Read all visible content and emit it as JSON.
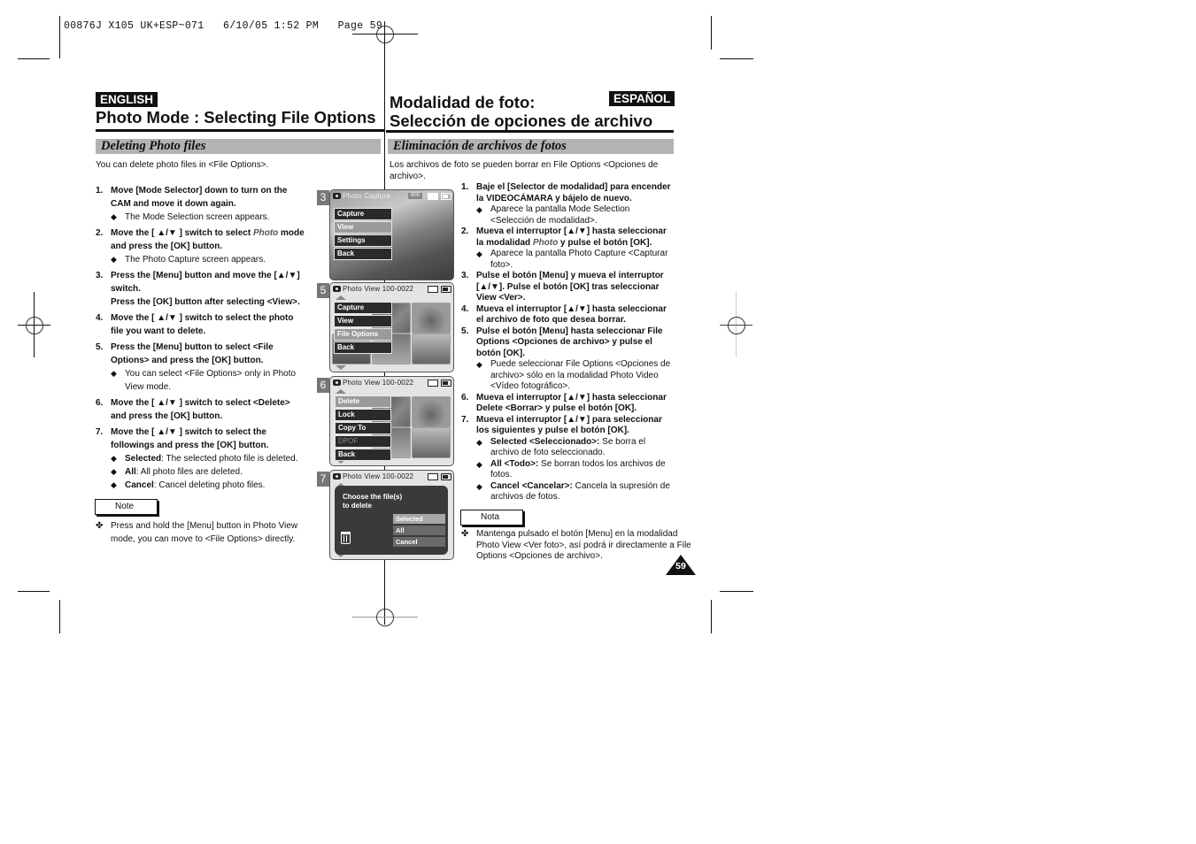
{
  "slug": "00876J X105 UK+ESP~071   6/10/05 1:52 PM   Page 59",
  "english": {
    "badge": "ENGLISH",
    "title": "Photo Mode : Selecting File Options",
    "section": "Deleting Photo files",
    "intro": "You can delete photo files in <File Options>.",
    "steps": [
      {
        "num": "1.",
        "text": "Move [Mode Selector] down to turn on the CAM and move it down again.",
        "bullets": [
          {
            "bold": "",
            "text": "The Mode Selection screen appears."
          }
        ]
      },
      {
        "num": "2.",
        "pre": "Move the [ ▲/▼ ] switch to select ",
        "ital": "Photo",
        "post": " mode and press the [OK] button.",
        "bullets": [
          {
            "bold": "",
            "text": "The Photo Capture screen appears."
          }
        ]
      },
      {
        "num": "3.",
        "text": "Press the [Menu] button and move the [▲/▼] switch.",
        "text2": "Press the [OK] button after selecting <View>.",
        "bullets": []
      },
      {
        "num": "4.",
        "text": "Move the [ ▲/▼ ] switch to select the photo file you want to delete.",
        "bullets": []
      },
      {
        "num": "5.",
        "text": "Press the [Menu] button to select <File Options> and press the [OK] button.",
        "bullets": [
          {
            "bold": "",
            "text": "You can select <File Options> only in Photo View mode."
          }
        ]
      },
      {
        "num": "6.",
        "text": "Move the [ ▲/▼ ] switch to select <Delete> and press the [OK] button.",
        "bullets": []
      },
      {
        "num": "7.",
        "text": "Move the [ ▲/▼ ] switch to select the followings and press the [OK] button.",
        "bullets": [
          {
            "bold": "Selected",
            "text": ": The selected photo file is deleted."
          },
          {
            "bold": "All",
            "text": ": All photo files are deleted."
          },
          {
            "bold": "Cancel",
            "text": ": Cancel deleting photo files."
          }
        ]
      }
    ],
    "note_label": "Note",
    "note_symbol": "✤",
    "note_text": "Press and hold the [Menu] button in Photo View mode, you can move to <File Options> directly."
  },
  "spanish": {
    "badge": "ESPAÑOL",
    "title_line1": "Modalidad de foto:",
    "title_line2": "Selección de opciones de archivo",
    "section": "Eliminación de archivos de fotos",
    "intro": "Los archivos de foto se pueden borrar en File Options <Opciones de archivo>.",
    "steps": [
      {
        "num": "1.",
        "text": "Baje el [Selector de modalidad] para encender la VIDEOCÁMARA y bájelo de nuevo.",
        "bullets": [
          {
            "bold": "",
            "text": "Aparece la pantalla Mode Selection <Selección de modalidad>."
          }
        ]
      },
      {
        "num": "2.",
        "pre": "Mueva el interruptor [▲/▼] hasta seleccionar la modalidad ",
        "ital": "Photo",
        "post": " y pulse el botón [OK].",
        "bullets": [
          {
            "bold": "",
            "text": "Aparece la pantalla Photo Capture <Capturar foto>."
          }
        ]
      },
      {
        "num": "3.",
        "text": "Pulse el botón [Menu] y mueva el interruptor [▲/▼]. Pulse el botón [OK] tras seleccionar View <Ver>.",
        "bullets": []
      },
      {
        "num": "4.",
        "text": "Mueva el interruptor [▲/▼] hasta seleccionar el archivo de foto que desea borrar.",
        "bullets": []
      },
      {
        "num": "5.",
        "text": "Pulse el botón [Menu] hasta seleccionar File Options <Opciones de archivo> y pulse el botón [OK].",
        "bullets": [
          {
            "bold": "",
            "text": "Puede seleccionar File Options <Opciones de archivo> sólo en la modalidad Photo Video <Vídeo fotográfico>."
          }
        ]
      },
      {
        "num": "6.",
        "text": "Mueva el interruptor [▲/▼] hasta seleccionar Delete <Borrar> y pulse el botón [OK].",
        "bullets": []
      },
      {
        "num": "7.",
        "text": "Mueva el interruptor [▲/▼] para seleccionar los siguientes y pulse el botón [OK].",
        "bullets": [
          {
            "bold": "Selected <Seleccionado>:",
            "text": " Se borra el archivo de foto seleccionado."
          },
          {
            "bold": "All <Todo>:",
            "text": " Se borran todos los archivos de fotos."
          },
          {
            "bold": "Cancel <Cancelar>:",
            "text": " Cancela la supresión de archivos de fotos."
          }
        ]
      }
    ],
    "note_label": "Nota",
    "note_symbol": "✤",
    "note_text": "Mantenga pulsado el botón [Menu] en la modalidad Photo View <Ver foto>, así podrá ir directamente a File Options <Opciones de archivo>."
  },
  "screens": [
    {
      "num": "3",
      "header": "Photo Capture",
      "badge": "800",
      "menu": [
        {
          "label": "Capture",
          "state": "normal"
        },
        {
          "label": "View",
          "state": "selected"
        },
        {
          "label": "Settings",
          "state": "normal"
        },
        {
          "label": "Back",
          "state": "normal"
        }
      ]
    },
    {
      "num": "5",
      "header": "Photo View",
      "file": "100-0022",
      "menu": [
        {
          "label": "Capture",
          "state": "normal"
        },
        {
          "label": "View",
          "state": "normal"
        },
        {
          "label": "File Options",
          "state": "selected"
        },
        {
          "label": "Back",
          "state": "normal"
        }
      ]
    },
    {
      "num": "6",
      "header": "Photo View",
      "file": "100-0022",
      "menu": [
        {
          "label": "Delete",
          "state": "selected"
        },
        {
          "label": "Lock",
          "state": "normal"
        },
        {
          "label": "Copy To",
          "state": "normal"
        },
        {
          "label": "DPOF",
          "state": "disabled"
        },
        {
          "label": "Back",
          "state": "normal"
        }
      ]
    },
    {
      "num": "7",
      "header": "Photo View",
      "file": "100-0022",
      "dialog": {
        "message_line1": "Choose the file(s)",
        "message_line2": "to delete",
        "options": [
          {
            "label": "Selected",
            "state": "selected"
          },
          {
            "label": "All",
            "state": "normal"
          },
          {
            "label": "Cancel",
            "state": "normal"
          }
        ]
      }
    }
  ],
  "page_number": "59"
}
